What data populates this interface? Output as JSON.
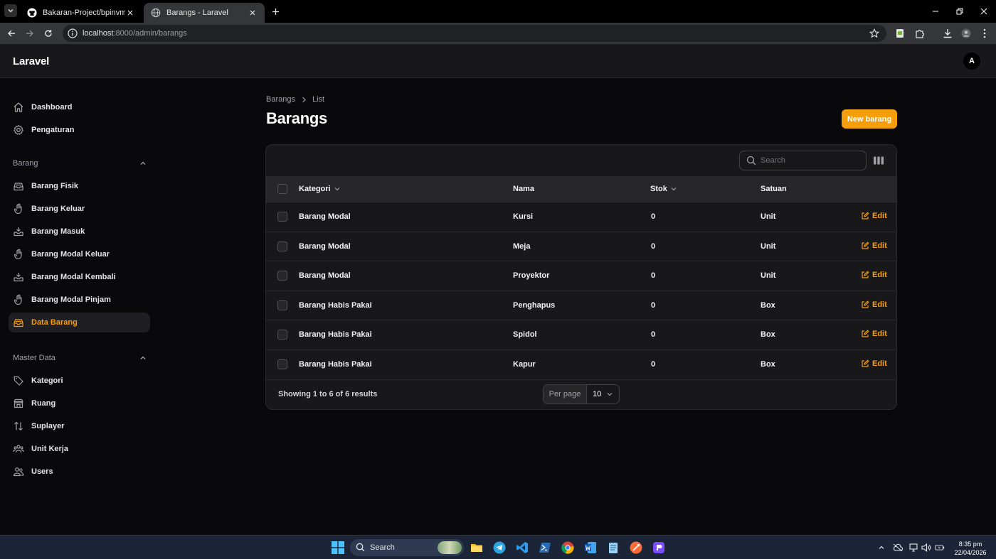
{
  "browser": {
    "tabs": [
      {
        "title": "Bakaran-Project/bpinvmono",
        "icon": "github-icon"
      },
      {
        "title": "Barangs - Laravel",
        "icon": "globe-icon"
      }
    ],
    "url_host": "localhost",
    "url_rest": ":8000/admin/barangs"
  },
  "app": {
    "brand": "Laravel",
    "user_initial": "A"
  },
  "sidebar": {
    "top_items": [
      {
        "label": "Dashboard",
        "icon": "home-icon"
      },
      {
        "label": "Pengaturan",
        "icon": "gear-icon"
      }
    ],
    "groups": [
      {
        "label": "Barang",
        "items": [
          {
            "label": "Barang Fisik",
            "icon": "inbox-stack-icon"
          },
          {
            "label": "Barang Keluar",
            "icon": "hand-raised-icon"
          },
          {
            "label": "Barang Masuk",
            "icon": "inbox-arrow-down-icon"
          },
          {
            "label": "Barang Modal Keluar",
            "icon": "hand-raised-icon"
          },
          {
            "label": "Barang Modal Kembali",
            "icon": "inbox-arrow-down-icon"
          },
          {
            "label": "Barang Modal Pinjam",
            "icon": "hand-raised-icon"
          },
          {
            "label": "Data Barang",
            "icon": "inbox-stack-icon",
            "active": true
          }
        ]
      },
      {
        "label": "Master Data",
        "items": [
          {
            "label": "Kategori",
            "icon": "tag-icon"
          },
          {
            "label": "Ruang",
            "icon": "building-storefront-icon"
          },
          {
            "label": "Suplayer",
            "icon": "arrows-up-down-icon"
          },
          {
            "label": "Unit Kerja",
            "icon": "user-group-icon"
          },
          {
            "label": "Users",
            "icon": "users-icon"
          }
        ]
      }
    ]
  },
  "main": {
    "breadcrumb": [
      "Barangs",
      "List"
    ],
    "title": "Barangs",
    "new_button": "New barang",
    "search_placeholder": "Search",
    "columns": [
      {
        "label": "Kategori",
        "sortable": true
      },
      {
        "label": "Nama",
        "sortable": false
      },
      {
        "label": "Stok",
        "sortable": true
      },
      {
        "label": "Satuan",
        "sortable": false
      }
    ],
    "rows": [
      {
        "kategori": "Barang Modal",
        "nama": "Kursi",
        "stok": "0",
        "satuan": "Unit"
      },
      {
        "kategori": "Barang Modal",
        "nama": "Meja",
        "stok": "0",
        "satuan": "Unit"
      },
      {
        "kategori": "Barang Modal",
        "nama": "Proyektor",
        "stok": "0",
        "satuan": "Unit"
      },
      {
        "kategori": "Barang Habis Pakai",
        "nama": "Penghapus",
        "stok": "0",
        "satuan": "Box"
      },
      {
        "kategori": "Barang Habis Pakai",
        "nama": "Spidol",
        "stok": "0",
        "satuan": "Box"
      },
      {
        "kategori": "Barang Habis Pakai",
        "nama": "Kapur",
        "stok": "0",
        "satuan": "Box"
      }
    ],
    "edit_label": "Edit",
    "results_text": "Showing 1 to 6 of 6 results",
    "per_page_label": "Per page",
    "per_page_value": "10"
  },
  "taskbar": {
    "search_label": "Search",
    "time": "8:35 pm",
    "date": "22/04/2026"
  },
  "colors": {
    "accent": "#f59e0b",
    "background": "#09090b",
    "card": "#18181b"
  }
}
